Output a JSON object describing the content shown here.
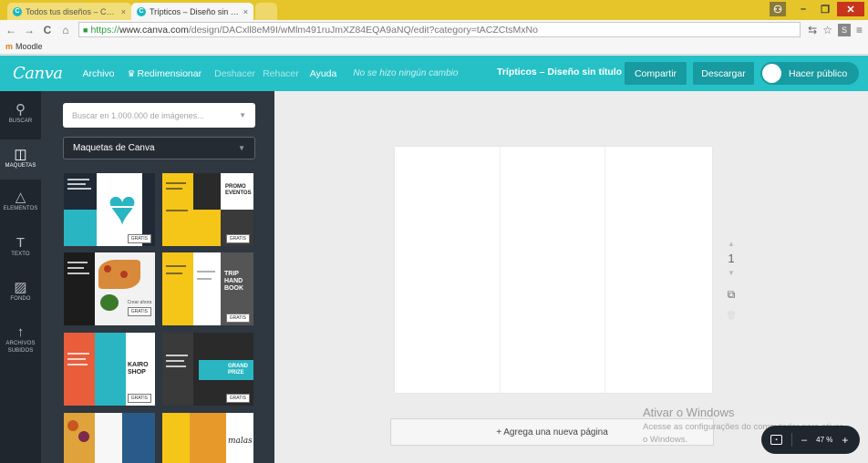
{
  "browser": {
    "tabs": [
      {
        "favicon": "C",
        "title": "Todos tus diseños – Canv",
        "close": "×"
      },
      {
        "favicon": "C",
        "title": "Trípticos – Diseño sin títul",
        "close": "×"
      }
    ],
    "window_controls": {
      "user": "⚇",
      "minimize": "–",
      "restore": "❐",
      "close": "✕"
    },
    "nav": {
      "back": "←",
      "forward": "→",
      "reload": "C",
      "home": "⌂"
    },
    "url": {
      "scheme": "https://",
      "host": "www.canva.com",
      "path": "/design/DACxll8eM9I/wMlm491ruJmXZ84EQA9aNQ/edit?category=tACZCtsMxNo"
    },
    "toolbar_icons": {
      "translate": "⇆",
      "star": "☆",
      "extension": "S",
      "menu": "≡"
    },
    "bookmarks": [
      {
        "label": "Moodle",
        "icon": "m"
      }
    ]
  },
  "header": {
    "logo": "Canva",
    "menu": {
      "archivo": "Archivo",
      "redimensionar": "Redimensionar",
      "deshacer": "Deshacer",
      "rehacer": "Rehacer",
      "ayuda": "Ayuda"
    },
    "status": "No se hizo ningún cambio",
    "doc_title": "Trípticos – Diseño sin título",
    "share": "Compartir",
    "download": "Descargar",
    "make_public": "Hacer público"
  },
  "sidebar": {
    "items": [
      {
        "glyph": "⚲",
        "label": "BUSCAR"
      },
      {
        "glyph": "◫",
        "label": "MAQUETAS"
      },
      {
        "glyph": "△",
        "label": "ELEMENTOS"
      },
      {
        "glyph": "T",
        "label": "TEXTO"
      },
      {
        "glyph": "▨",
        "label": "FONDO"
      },
      {
        "glyph": "↑",
        "label": "ARCHIVOS SUBIDOS"
      }
    ]
  },
  "panel": {
    "search_placeholder": "Buscar en 1.000.000 de imágenes...",
    "select_value": "Maquetas de Canva",
    "caret": "▼",
    "gratis": "GRATIS",
    "thumb_text": {
      "t2": "PROMO EVENTOS",
      "t4": "Crear ahora",
      "t5": "TRIP HAND BOOK",
      "t6": "KAIRO SHOP",
      "t7": "GRAND PRIZE",
      "t9": "malas"
    }
  },
  "canvas": {
    "page_number": "1",
    "tool_up": "▲",
    "tool_down": "▼",
    "tool_copy": "⧉",
    "tool_delete": "🗑",
    "add_page": "+ Agrega una nueva página"
  },
  "watermark": {
    "title": "Ativar o Windows",
    "subtitle": "Acesse as configurações do computador para ativar o Windows."
  },
  "zoom": {
    "minus": "–",
    "value": "47 %",
    "plus": "+"
  }
}
